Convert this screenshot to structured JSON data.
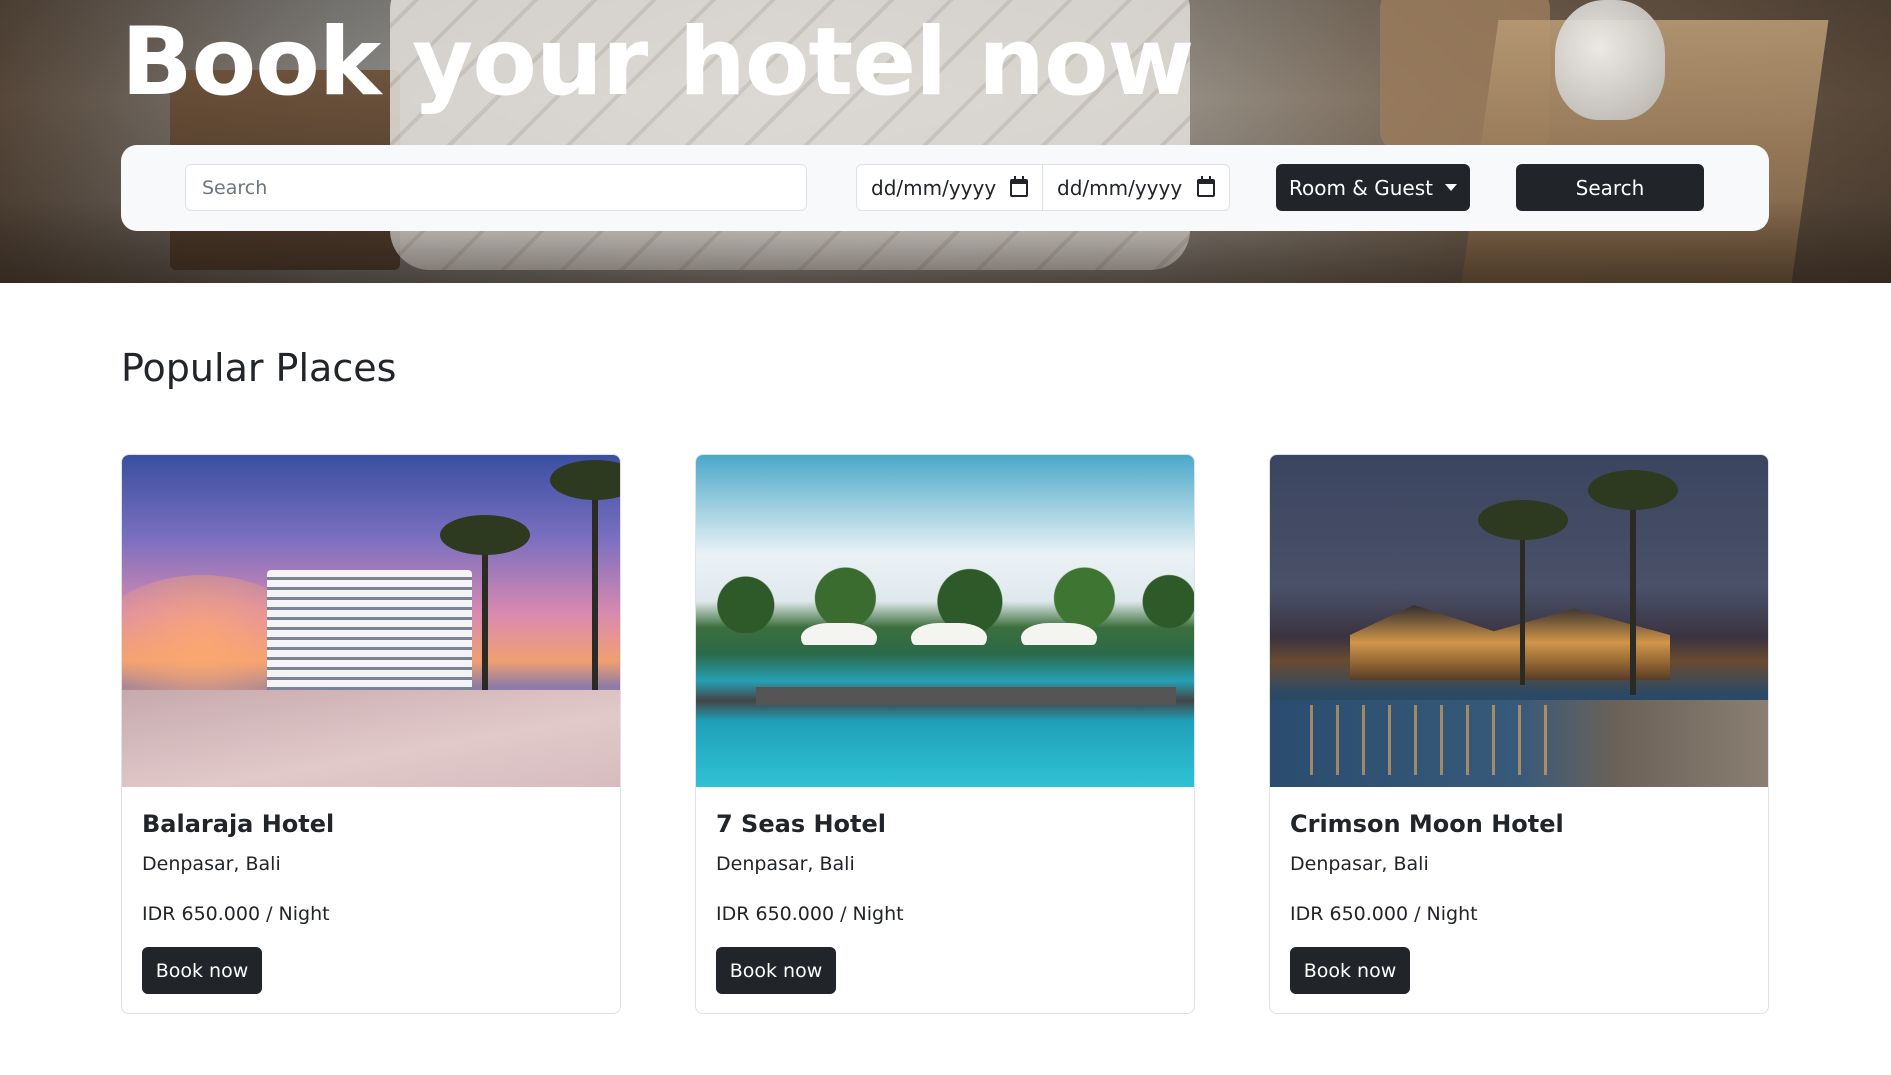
{
  "hero": {
    "title": "Book your hotel now"
  },
  "search": {
    "placeholder": "Search",
    "checkin_display": "dd/mm/yyyy",
    "checkout_display": "dd/mm/yyyy",
    "room_guest_label": "Room & Guest",
    "search_button_label": "Search"
  },
  "popular": {
    "heading": "Popular Places",
    "cards": [
      {
        "name": "Balaraja Hotel",
        "location": "Denpasar, Bali",
        "price": "IDR 650.000 / Night",
        "button": "Book now"
      },
      {
        "name": "7 Seas Hotel",
        "location": "Denpasar, Bali",
        "price": "IDR 650.000 / Night",
        "button": "Book now"
      },
      {
        "name": "Crimson Moon Hotel",
        "location": "Denpasar, Bali",
        "price": "IDR 650.000 / Night",
        "button": "Book now"
      }
    ]
  },
  "colors": {
    "button_dark": "#212529",
    "search_bar_bg": "#f8f9fa",
    "border": "#dee2e6"
  },
  "icons": {
    "date_picker": "calendar-icon",
    "dropdown": "caret-down-icon"
  }
}
